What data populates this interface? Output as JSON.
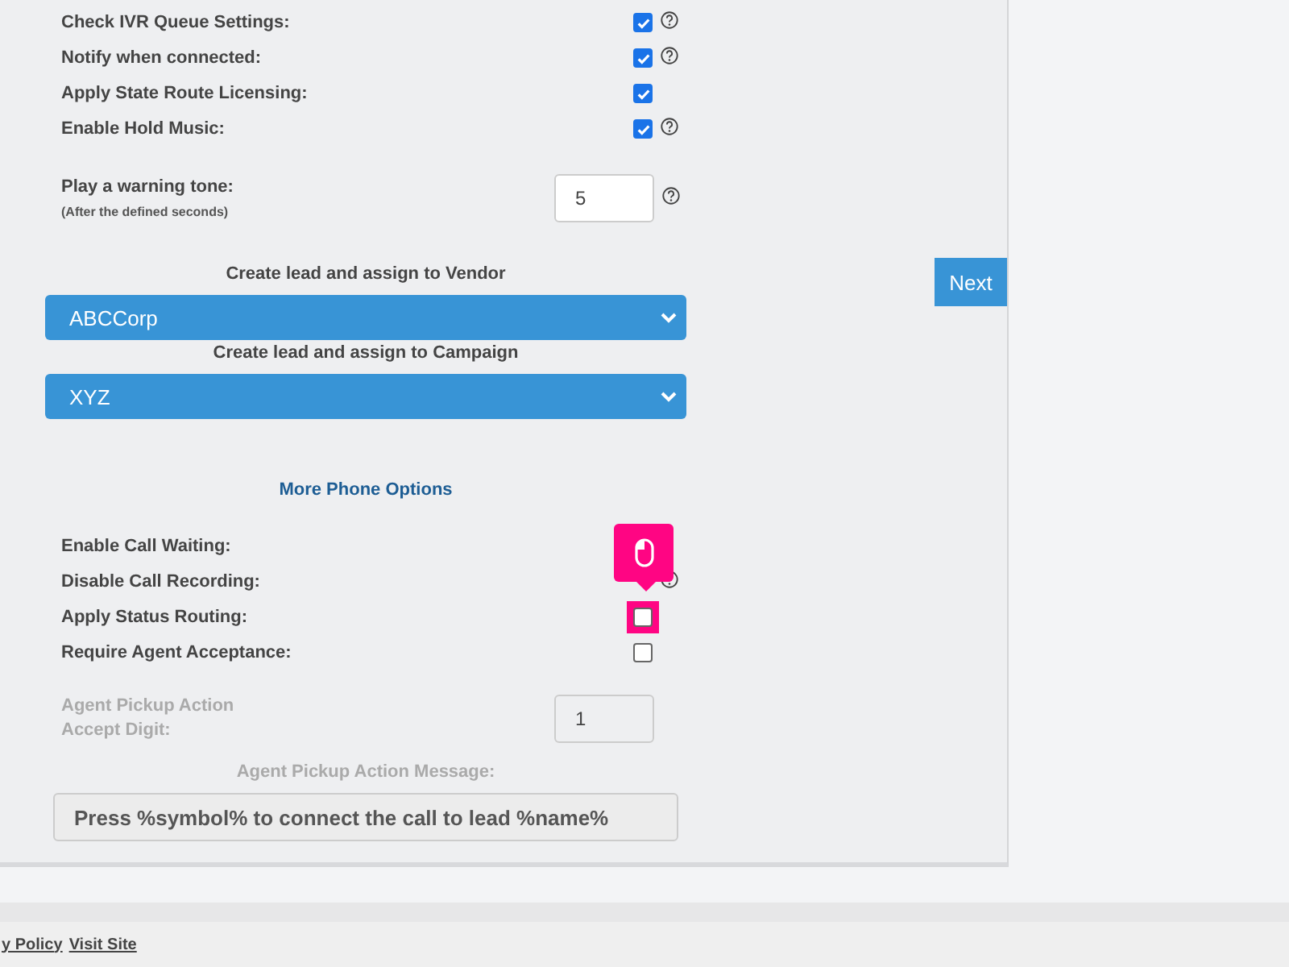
{
  "top_settings": [
    {
      "label": "Check IVR Queue Settings:",
      "checked": true,
      "help": true
    },
    {
      "label": "Notify when connected:",
      "checked": true,
      "help": true
    },
    {
      "label": "Apply State Route Licensing:",
      "checked": true,
      "help": false
    },
    {
      "label": "Enable Hold Music:",
      "checked": true,
      "help": true
    }
  ],
  "warning_tone": {
    "label": "Play a warning tone:",
    "hint": "(After the defined seconds)",
    "value": "5",
    "help": true
  },
  "vendor": {
    "label": "Create lead and assign to Vendor",
    "value": "ABCCorp"
  },
  "campaign": {
    "label": "Create lead and assign to Campaign",
    "value": "XYZ"
  },
  "next_button": "Next",
  "more_link": "More Phone Options",
  "phone_settings": [
    {
      "label": "Enable Call Waiting:",
      "help": false
    },
    {
      "label": "Disable Call Recording:",
      "help": true
    },
    {
      "label": "Apply Status Routing:",
      "checked": false,
      "help": false,
      "highlighted": true
    },
    {
      "label": "Require Agent Acceptance:",
      "checked": false,
      "help": false
    }
  ],
  "pickup_digit": {
    "label": "Agent Pickup Action Accept Digit:",
    "value": "1",
    "disabled": true
  },
  "pickup_message": {
    "label": "Agent Pickup Action Message:",
    "value": "Press %symbol% to connect the call to lead %name%",
    "disabled": true
  },
  "footer_links": [
    "y Policy",
    "Visit Site"
  ]
}
